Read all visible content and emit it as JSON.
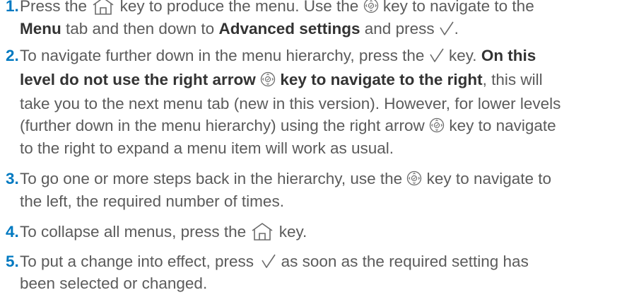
{
  "steps": [
    {
      "number": "1.",
      "segments": {
        "a": "Press the",
        "b": "key to produce the menu. Use the",
        "c": "key to navigate to the",
        "d": "Menu",
        "e": "tab and then down to",
        "f": "Advanced settings",
        "g": "and press",
        "h": "."
      }
    },
    {
      "number": "2.",
      "segments": {
        "a": "To navigate further down in the menu hierarchy, press the",
        "b": "key.",
        "c": "On this",
        "d": "level do not use the right arrow",
        "e": "key to navigate to the right",
        "f": ", this will",
        "g": "take you to the next menu tab (new in this version). However, for lower levels",
        "h": "(further down in the menu hierarchy) using the right arrow",
        "i": "key to navigate",
        "j": "to the right to expand a menu item will work as usual."
      }
    },
    {
      "number": "3.",
      "segments": {
        "a": "To go one or more steps back in the hierarchy, use the",
        "b": "key to navigate to",
        "c": "the left, the required number of times."
      }
    },
    {
      "number": "4.",
      "segments": {
        "a": "To collapse all menus, press the",
        "b": "key."
      }
    },
    {
      "number": "5.",
      "segments": {
        "a": "To put a change into effect, press",
        "b": "as soon as the required setting has",
        "c": "been selected or changed."
      }
    }
  ],
  "icons": {
    "home": "home-key-icon",
    "navigate": "navigation-key-icon",
    "select": "checkmark-key-icon"
  },
  "colors": {
    "accent": "#0079c1",
    "text": "#5b5b5b",
    "bold_text": "#333333"
  }
}
